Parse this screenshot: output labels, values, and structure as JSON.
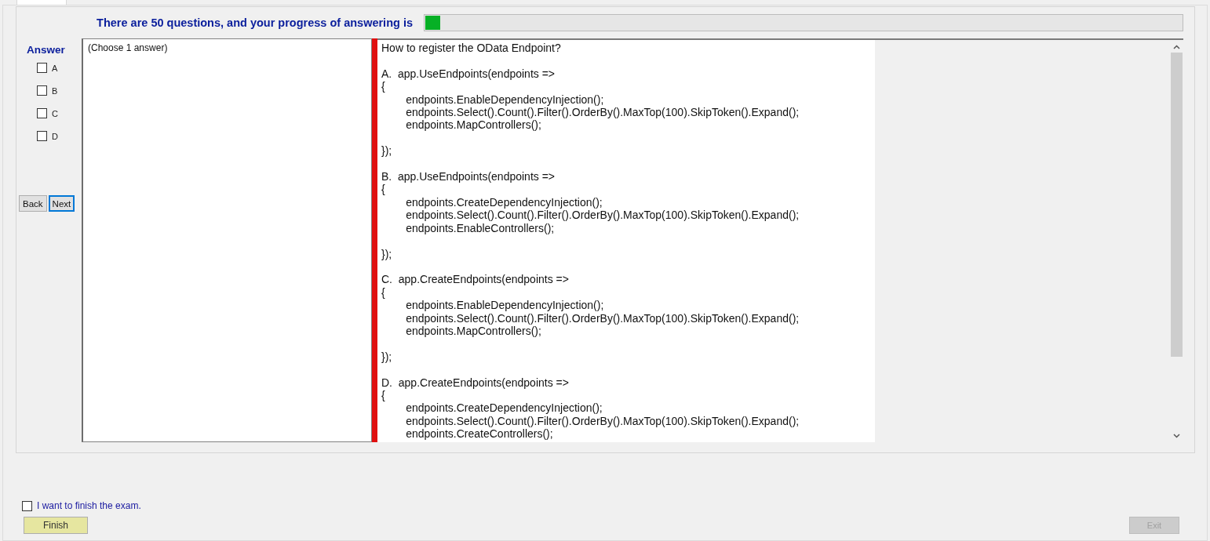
{
  "progress": {
    "label": "There are 50 questions, and your progress of answering is",
    "level": 0.02
  },
  "answer_panel": {
    "title": "Answer",
    "options": [
      {
        "label": "A",
        "checked": false
      },
      {
        "label": "B",
        "checked": false
      },
      {
        "label": "C",
        "checked": false
      },
      {
        "label": "D",
        "checked": false
      }
    ]
  },
  "nav_buttons": [
    {
      "label": "Back",
      "focused": false
    },
    {
      "label": "Next",
      "focused": true
    }
  ],
  "instruction": "(Choose 1 answer)",
  "question": "How to register the OData Endpoint?\n\nA.  app.UseEndpoints(endpoints =>\n{\n\tendpoints.EnableDependencyInjection();\n\tendpoints.Select().Count().Filter().OrderBy().MaxTop(100).SkipToken().Expand();\n\tendpoints.MapControllers();\n\n});\n\nB.  app.UseEndpoints(endpoints =>\n{\n\tendpoints.CreateDependencyInjection();\n\tendpoints.Select().Count().Filter().OrderBy().MaxTop(100).SkipToken().Expand();\n\tendpoints.EnableControllers();\n\n});\n\nC.  app.CreateEndpoints(endpoints =>\n{\n\tendpoints.EnableDependencyInjection();\n\tendpoints.Select().Count().Filter().OrderBy().MaxTop(100).SkipToken().Expand();\n\tendpoints.MapControllers();\n\n});\n\nD.  app.CreateEndpoints(endpoints =>\n{\n\tendpoints.CreateDependencyInjection();\n\tendpoints.Select().Count().Filter().OrderBy().MaxTop(100).SkipToken().Expand();\n\tendpoints.CreateControllers();",
  "finish": {
    "label": "I want to finish the exam.",
    "checked": false,
    "button": "Finish"
  },
  "exit_button": {
    "label": "Exit",
    "disabled": true
  }
}
